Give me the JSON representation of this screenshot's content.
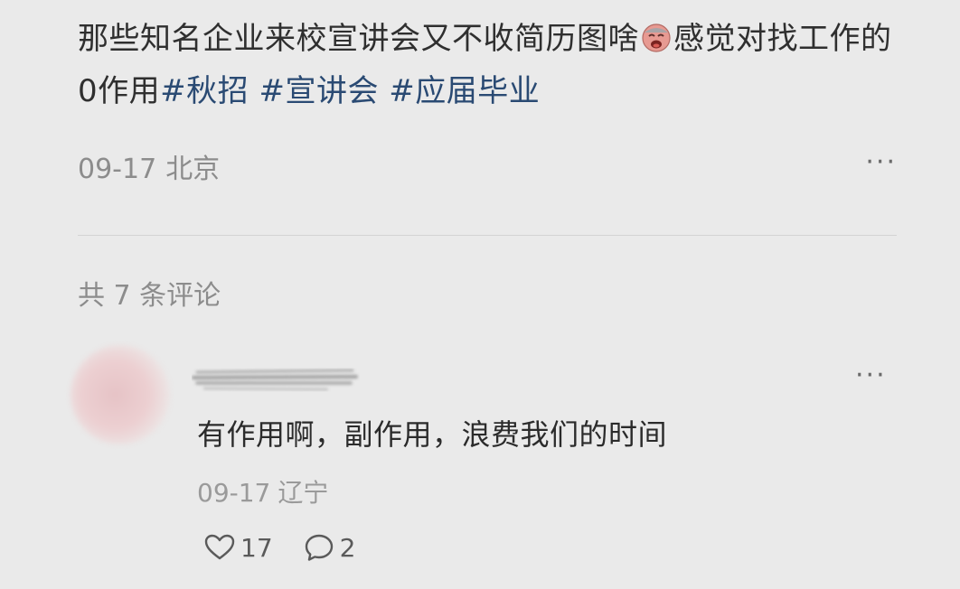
{
  "post": {
    "text": "那些知名企业来校宣讲会又不收简历图啥",
    "text_after_emoji": "感觉对找工作的0作用",
    "hashtags": [
      "#秋招",
      "#宣讲会",
      "#应届毕业"
    ],
    "emoji": "sad-face-emoji",
    "date": "09-17",
    "location": "北京",
    "more": "···"
  },
  "comments_header": "共 7 条评论",
  "comment": {
    "text": "有作用啊，副作用，浪费我们的时间",
    "date": "09-17",
    "location": "辽宁",
    "likes": "17",
    "replies": "2",
    "more": "···"
  },
  "colors": {
    "background": "#eaeaea",
    "hashtag": "#2a4a73",
    "meta": "#8c8c8c"
  }
}
